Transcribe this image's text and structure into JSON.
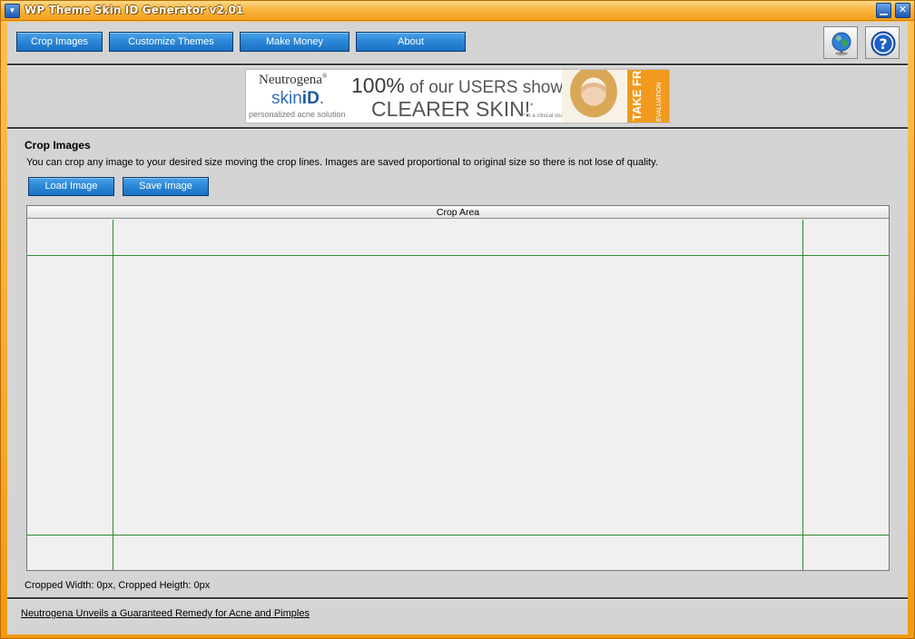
{
  "window": {
    "title": "WP Theme Skin ID Generator v2.01",
    "sysmenu_glyph": "▼",
    "minimize_glyph": "▁",
    "close_glyph": "✕"
  },
  "nav": [
    {
      "label": "Crop Images"
    },
    {
      "label": "Customize Themes"
    },
    {
      "label": "Make Money"
    },
    {
      "label": "About"
    }
  ],
  "icons": {
    "globe": "globe-icon",
    "help": "help-icon"
  },
  "banner": {
    "brand": "Neutrogena",
    "brand_mark": "®",
    "product_light": "skin",
    "product_bold": "iD",
    "product_mark": ".",
    "tagline": "personalized acne solution",
    "headline_big": "100%",
    "headline_rest": " of our USERS showed",
    "headline2": "CLEARER SKIN!",
    "headline2_mark": "*",
    "footnote": "* in a clinical study",
    "cta": "TAKE FREE",
    "cta_small": "EVALUATION"
  },
  "content": {
    "title": "Crop Images",
    "description": "You can crop any image to your desired size moving the crop lines. Images are saved proportional to original size so there is not lose of quality.",
    "load_label": "Load Image",
    "save_label": "Save Image",
    "crop_header": "Crop Area",
    "status": "Cropped Width: 0px, Cropped Heigth: 0px"
  },
  "footer": {
    "link": "Neutrogena Unveils a Guaranteed Remedy for Acne and Pimples"
  },
  "colors": {
    "frame": "#f7a21b",
    "button": "#2a86d6",
    "crop_line": "#2f8a2f",
    "banner_cta": "#f29a1e"
  }
}
